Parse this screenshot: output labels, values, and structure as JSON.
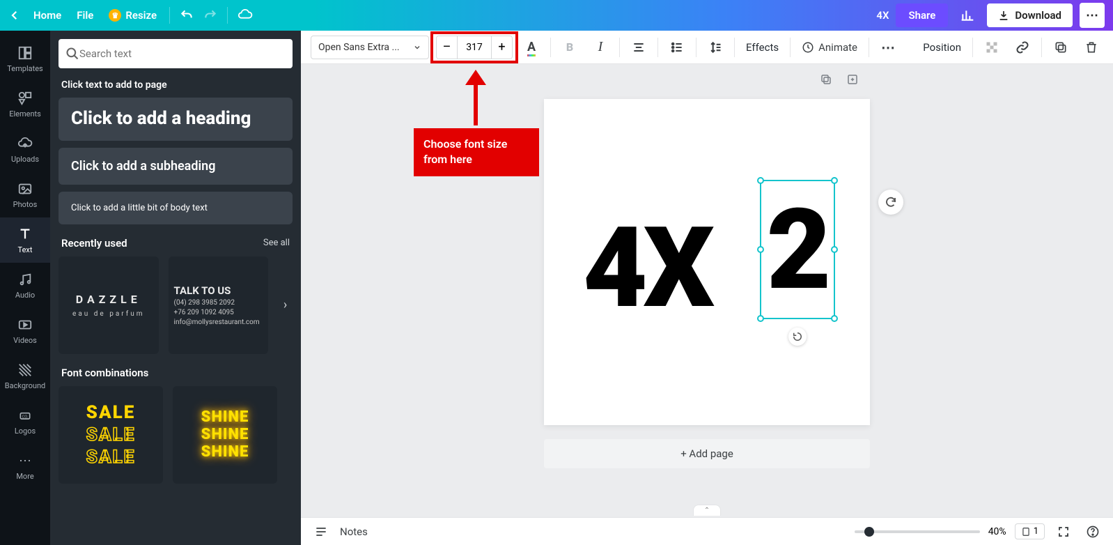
{
  "topbar": {
    "home": "Home",
    "file": "File",
    "resize": "Resize",
    "doc_title": "4X",
    "share": "Share",
    "download": "Download"
  },
  "sidenav": {
    "templates": "Templates",
    "elements": "Elements",
    "uploads": "Uploads",
    "photos": "Photos",
    "text": "Text",
    "audio": "Audio",
    "videos": "Videos",
    "background": "Background",
    "logos": "Logos",
    "more": "More"
  },
  "panel": {
    "search_placeholder": "Search text",
    "hint": "Click text to add to page",
    "add_heading": "Click to add a heading",
    "add_subheading": "Click to add a subheading",
    "add_body": "Click to add a little bit of body text",
    "recently_used": "Recently used",
    "see_all": "See all",
    "font_combos": "Font combinations",
    "dazzle_title": "DAZZLE",
    "dazzle_sub": "eau de parfum",
    "talk_title": "TALK TO US",
    "talk_l1": "(04) 298 3985 2092",
    "talk_l2": "+76 209 1092 4095",
    "talk_l3": "info@mollysrestaurant.com",
    "sale": "SALE",
    "shine": "SHINE"
  },
  "toolbar": {
    "font_name": "Open Sans Extra ...",
    "font_size": "317",
    "effects": "Effects",
    "animate": "Animate",
    "position": "Position"
  },
  "annotation": {
    "label": "Choose font size from here"
  },
  "canvas": {
    "text1": "4X",
    "text2": "2",
    "add_page": "+ Add page"
  },
  "bottombar": {
    "notes": "Notes",
    "zoom": "40%",
    "pages": "1"
  }
}
